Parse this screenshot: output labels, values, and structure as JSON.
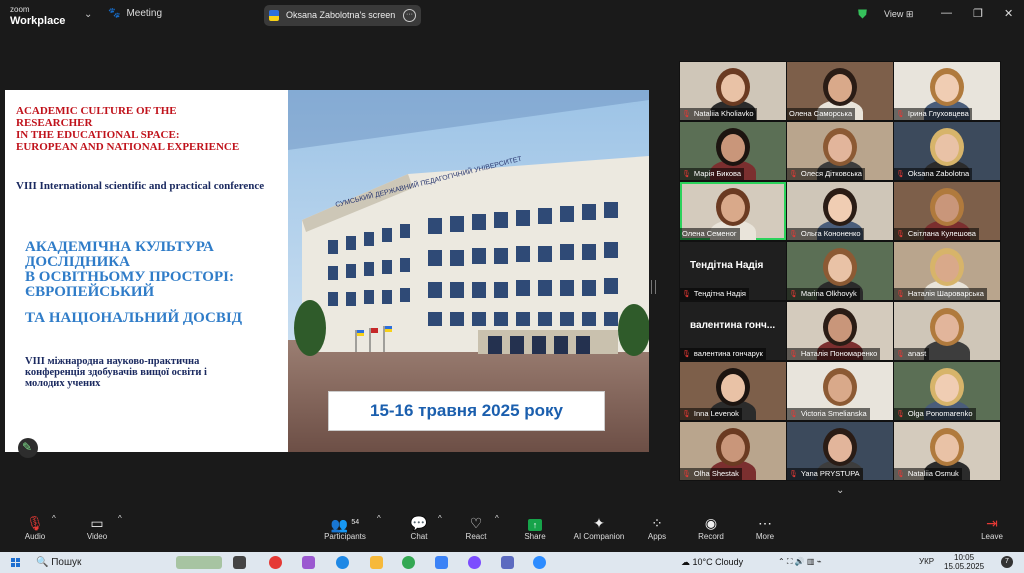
{
  "app": {
    "logo_top": "zoom",
    "logo_bottom": "Workplace",
    "meeting_label": "Meeting"
  },
  "share": {
    "label": "Oksana Zabolotna's screen"
  },
  "header": {
    "view_label": "View"
  },
  "slide": {
    "title_en": [
      "ACADEMIC CULTURE OF THE",
      "RESEARCHER",
      "IN THE EDUCATIONAL SPACE:",
      "EUROPEAN AND NATIONAL EXPERIENCE"
    ],
    "conf_en": "VIII International scientific and practical conference",
    "title_ua": [
      "АКАДЕМІЧНА КУЛЬТУРА",
      "ДОСЛІДНИКА",
      "В ОСВІТНЬОМУ ПРОСТОРІ:",
      "ЄВРОПЕЙСЬКИЙ",
      "ТА НАЦІОНАЛЬНИЙ ДОСВІД"
    ],
    "conf_ua": [
      "VIII міжнародна науково-практична",
      "конференція здобувачів вищої освіти і",
      "молодих учених"
    ],
    "building_sign": "СУМСЬКИЙ ДЕРЖАВНИЙ ПЕДАГОГІЧНИЙ УНІВЕРСИТЕТ",
    "dates": "15-16 травня 2025 року"
  },
  "participants": [
    {
      "name": "Nataliia Kholiavko",
      "muted": true
    },
    {
      "name": "Олена Саморська",
      "muted": false
    },
    {
      "name": "Ірина Глуховцева",
      "muted": true
    },
    {
      "name": "Марія Бикова",
      "muted": true
    },
    {
      "name": "Олеся Дітковська",
      "muted": true
    },
    {
      "name": "Oksana Zabolotna",
      "muted": true
    },
    {
      "name": "Олена Семеног",
      "muted": false
    },
    {
      "name": "Ольга Кононенко",
      "muted": true
    },
    {
      "name": "Світлана Кулешова",
      "muted": true
    },
    {
      "name": "Тендітна Надія",
      "muted": true,
      "big": "Тендітна Надія"
    },
    {
      "name": "Marina Olkhovyk",
      "muted": true
    },
    {
      "name": "Наталія Шароварська",
      "muted": true
    },
    {
      "name": "валентина гончарук",
      "muted": true,
      "big": "валентина гонч..."
    },
    {
      "name": "Наталія Пономаренко",
      "muted": true
    },
    {
      "name": "anast",
      "muted": true
    },
    {
      "name": "Inna Levenok",
      "muted": true
    },
    {
      "name": "Victoria Smelianska",
      "muted": true
    },
    {
      "name": "Olga Ponomarenko",
      "muted": true
    },
    {
      "name": "Olha Shestak",
      "muted": true
    },
    {
      "name": "Yana PRYSTUPA",
      "muted": true
    },
    {
      "name": "Nataliia Osmuk",
      "muted": true
    }
  ],
  "toolbar": {
    "audio": "Audio",
    "video": "Video",
    "participants": "Participants",
    "participants_count": "54",
    "chat": "Chat",
    "react": "React",
    "share": "Share",
    "ai": "AI Companion",
    "apps": "Apps",
    "record": "Record",
    "more": "More",
    "leave": "Leave"
  },
  "taskbar": {
    "search": "Пошук",
    "weather": "10°C  Cloudy",
    "lang": "УКР",
    "time": "10:05",
    "date": "15.05.2025",
    "notifications": "7"
  },
  "colors": {
    "accent_green": "#2bd25b",
    "muted_red": "#e53935",
    "share_green": "#16a34a",
    "leave_red": "#e53935"
  }
}
